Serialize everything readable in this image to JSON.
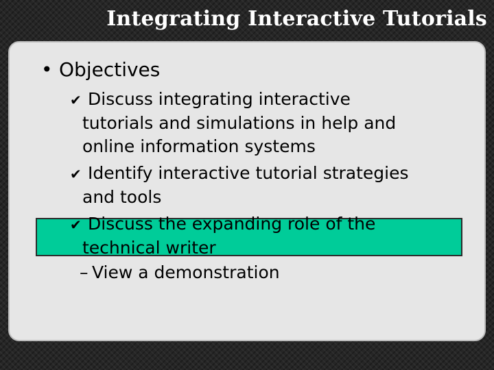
{
  "slide": {
    "title": "Integrating Interactive Tutorials",
    "heading_bullet": "•",
    "heading": "Objectives",
    "check_glyph": "✔",
    "dash_glyph": "–",
    "items": [
      {
        "lines": [
          "Discuss integrating interactive",
          "tutorials and simulations in help and",
          "online information systems"
        ],
        "icon": "checkmark-icon"
      },
      {
        "lines": [
          "Identify interactive tutorial strategies",
          "and tools"
        ],
        "icon": "checkmark-icon"
      },
      {
        "lines": [
          "Discuss the expanding role of the",
          "technical writer"
        ],
        "icon": "checkmark-icon",
        "highlighted": true
      }
    ],
    "sub_item": "View a demonstration"
  },
  "colors": {
    "background": "#262626",
    "panel": "#e6e6e6",
    "highlight": "#00cc99",
    "title_text": "#ffffff"
  }
}
